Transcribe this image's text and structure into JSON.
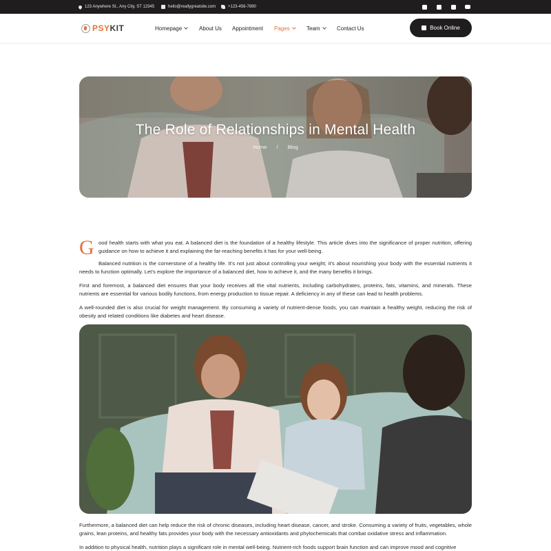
{
  "topbar": {
    "address": "123 Anywhere St., Any City, ST 12345",
    "email": "hello@reallygreatsite.com",
    "phone": "+123-456-7890",
    "social": [
      "facebook-icon",
      "instagram-icon",
      "twitter-icon",
      "youtube-icon"
    ]
  },
  "header": {
    "logo_part1": "PSY",
    "logo_part2": "KIT",
    "nav": [
      "Homepage",
      "About Us",
      "Appointment",
      "Pages",
      "Team",
      "Contact Us"
    ],
    "active_nav": "Pages",
    "book_label": "Book Online"
  },
  "hero": {
    "title": "The Role of Relationships in Mental Health",
    "breadcrumb": [
      "Home",
      "/",
      "Blog"
    ]
  },
  "article": {
    "dropcap": "G",
    "p1": "ood health starts with what you eat. A balanced diet is the foundation of a healthy lifestyle. This article dives into the significance of proper nutrition, offering guidance on how to achieve it and explaining the far-reaching benefits it has for your well-being.",
    "p2": "Balanced nutrition is the cornerstone of a healthy life. It’s not just about controlling your weight; it’s about nourishing your body with the essential nutrients it needs to function optimally. Let’s explore the importance of a balanced diet, how to achieve it, and the many benefits it brings.",
    "p3": "First and foremost, a balanced diet ensures that your body receives all the vital nutrients, including carbohydrates, proteins, fats, vitamins, and minerals. These nutrients are essential for various bodily functions, from energy production to tissue repair. A deficiency in any of these can lead to health problems.",
    "p4": "A well-rounded diet is also crucial for weight management. By consuming a variety of nutrient-dense foods, you can maintain a healthy weight, reducing the risk of obesity and related conditions like diabetes and heart disease.",
    "p5": "Furthermore, a balanced diet can help reduce the risk of chronic diseases, including heart disease, cancer, and stroke. Consuming a variety of fruits, vegetables, whole grains, lean proteins, and healthy fats provides your body with the necessary antioxidants and phytochemicals that combat oxidative stress and inflammation.",
    "p6": "In addition to physical health, nutrition plays a significant role in mental well-being. Nutrient-rich foods support brain function and can improve mood and cognitive"
  },
  "colors": {
    "accent": "#e3733b",
    "dark": "#1f1d1e"
  }
}
